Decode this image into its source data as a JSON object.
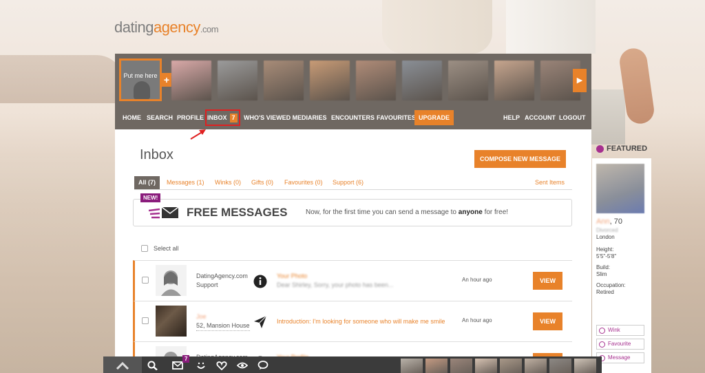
{
  "logo": {
    "part1": "dating",
    "part2": "agency",
    "part3": ".com"
  },
  "photostrip": {
    "put_me_here": "Put me here",
    "thumb_colors": [
      "#d9a9a8",
      "#9b9b9b",
      "#a88c78",
      "#c89b76",
      "#b08c78",
      "#8a8f96",
      "#9c8f84",
      "#c6a58e",
      "#9a8478"
    ]
  },
  "nav": {
    "home": "HOME",
    "search": "SEARCH",
    "profile": "PROFILE",
    "inbox": "INBOX",
    "inbox_count": "7",
    "whos_viewed": "WHO'S VIEWED ME",
    "diaries": "DIARIES",
    "encounters": "ENCOUNTERS",
    "favourites": "FAVOURITES",
    "upgrade": "UPGRADE",
    "help": "HELP",
    "account": "ACCOUNT",
    "logout": "LOGOUT"
  },
  "inbox": {
    "title": "Inbox",
    "compose_label": "COMPOSE NEW MESSAGE",
    "tabs": [
      {
        "label": "All (7)"
      },
      {
        "label": "Messages (1)"
      },
      {
        "label": "Winks (0)"
      },
      {
        "label": "Gifts (0)"
      },
      {
        "label": "Favourites (0)"
      },
      {
        "label": "Support (6)"
      }
    ],
    "sent_items": "Sent Items",
    "promo": {
      "badge": "NEW!",
      "title": "FREE MESSAGES",
      "desc_before": "Now, for the first time you can send a message to ",
      "desc_bold": "anyone",
      "desc_after": " for free!"
    },
    "select_all": "Select all",
    "messages": [
      {
        "sender": "DatingAgency.com",
        "sender_sub": "Support",
        "icon": "info-icon",
        "subject": "Your Photo",
        "preview": "Dear Shirley, Sorry, your photo has been...",
        "time": "An hour ago",
        "view": "VIEW"
      },
      {
        "sender": "Joe",
        "sender_sub": "52, Mansion House",
        "icon": "paper-plane-icon",
        "subject": "Introduction: I'm looking for someone who will make me smile",
        "time": "An hour ago",
        "view": "VIEW"
      },
      {
        "sender": "DatingAgency.com",
        "icon": "info-icon",
        "subject": "Your Profile",
        "view": "VIEW"
      }
    ]
  },
  "featured": {
    "heading": "FEATURED",
    "name": "Ann",
    "age": "70",
    "subtitle": "Divorced",
    "city": "London",
    "height_label": "Height:",
    "height_value": "5'5\"-5'8\"",
    "build_label": "Build:",
    "build_value": "Slim",
    "occupation_label": "Occupation:",
    "occupation_value": "Retired",
    "wink": "Wink",
    "favourite": "Favourite",
    "message": "Message"
  },
  "bottombar": {
    "badge": "7",
    "thumb_colors": [
      "#b9b2a9",
      "#c49a82",
      "#9a857a",
      "#d6c2b2",
      "#a89888",
      "#bfb0a2",
      "#8c8884",
      "#cfc4b8"
    ]
  },
  "colors": {
    "accent": "#e8822a",
    "nav_bg": "#6f6862",
    "purple": "#8a1c7c"
  }
}
